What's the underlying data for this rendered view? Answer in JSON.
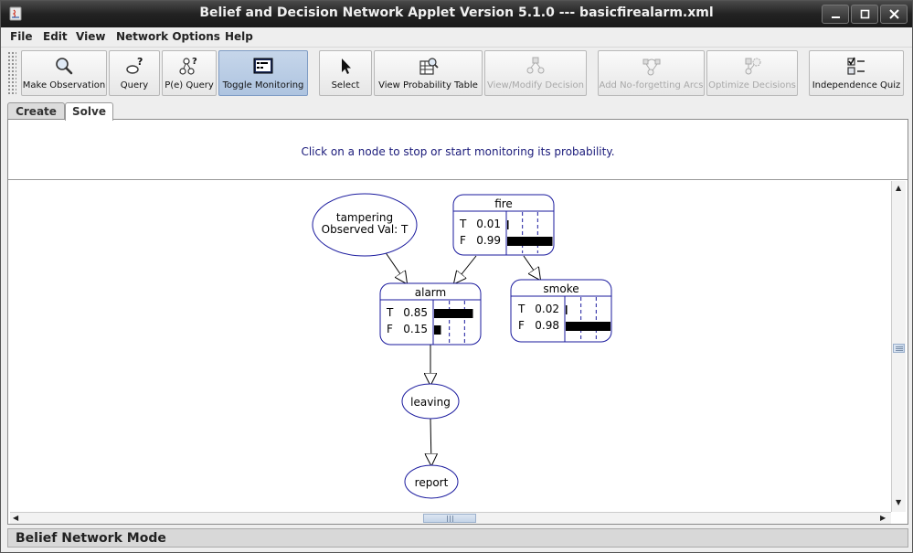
{
  "window": {
    "title": "Belief and Decision Network Applet Version 5.1.0 --- basicfirealarm.xml"
  },
  "menu": {
    "file": "File",
    "edit": "Edit",
    "view": "View",
    "network_options": "Network Options",
    "help": "Help"
  },
  "toolbar": {
    "make_observation": "Make Observation",
    "query": "Query",
    "pe_query": "P(e) Query",
    "toggle_monitoring": "Toggle Monitoring",
    "select": "Select",
    "view_probability_table": "View Probability Table",
    "view_modify_decision": "View/Modify Decision",
    "add_noforgetting_arcs": "Add No-forgetting Arcs",
    "optimize_decisions": "Optimize Decisions",
    "independence_quiz": "Independence Quiz"
  },
  "tabs": {
    "create": "Create",
    "solve": "Solve"
  },
  "message": "Click on a node to stop or start monitoring its probability.",
  "network": {
    "tampering": {
      "name": "tampering",
      "observed": "Observed Val: T"
    },
    "fire": {
      "name": "fire",
      "t_label": "T",
      "t_value": 0.01,
      "t_text": "0.01",
      "f_label": "F",
      "f_value": 0.99,
      "f_text": "0.99"
    },
    "alarm": {
      "name": "alarm",
      "t_label": "T",
      "t_value": 0.85,
      "t_text": "0.85",
      "f_label": "F",
      "f_value": 0.15,
      "f_text": "0.15"
    },
    "smoke": {
      "name": "smoke",
      "t_label": "T",
      "t_value": 0.02,
      "t_text": "0.02",
      "f_label": "F",
      "f_value": 0.98,
      "f_text": "0.98"
    },
    "leaving": {
      "name": "leaving"
    },
    "report": {
      "name": "report"
    }
  },
  "status": "Belief Network Mode",
  "colors": {
    "node_border": "#1a1a9e",
    "bar_fill": "#000000",
    "message_text": "#1a1a7a",
    "active_button": "#aec4e0"
  }
}
